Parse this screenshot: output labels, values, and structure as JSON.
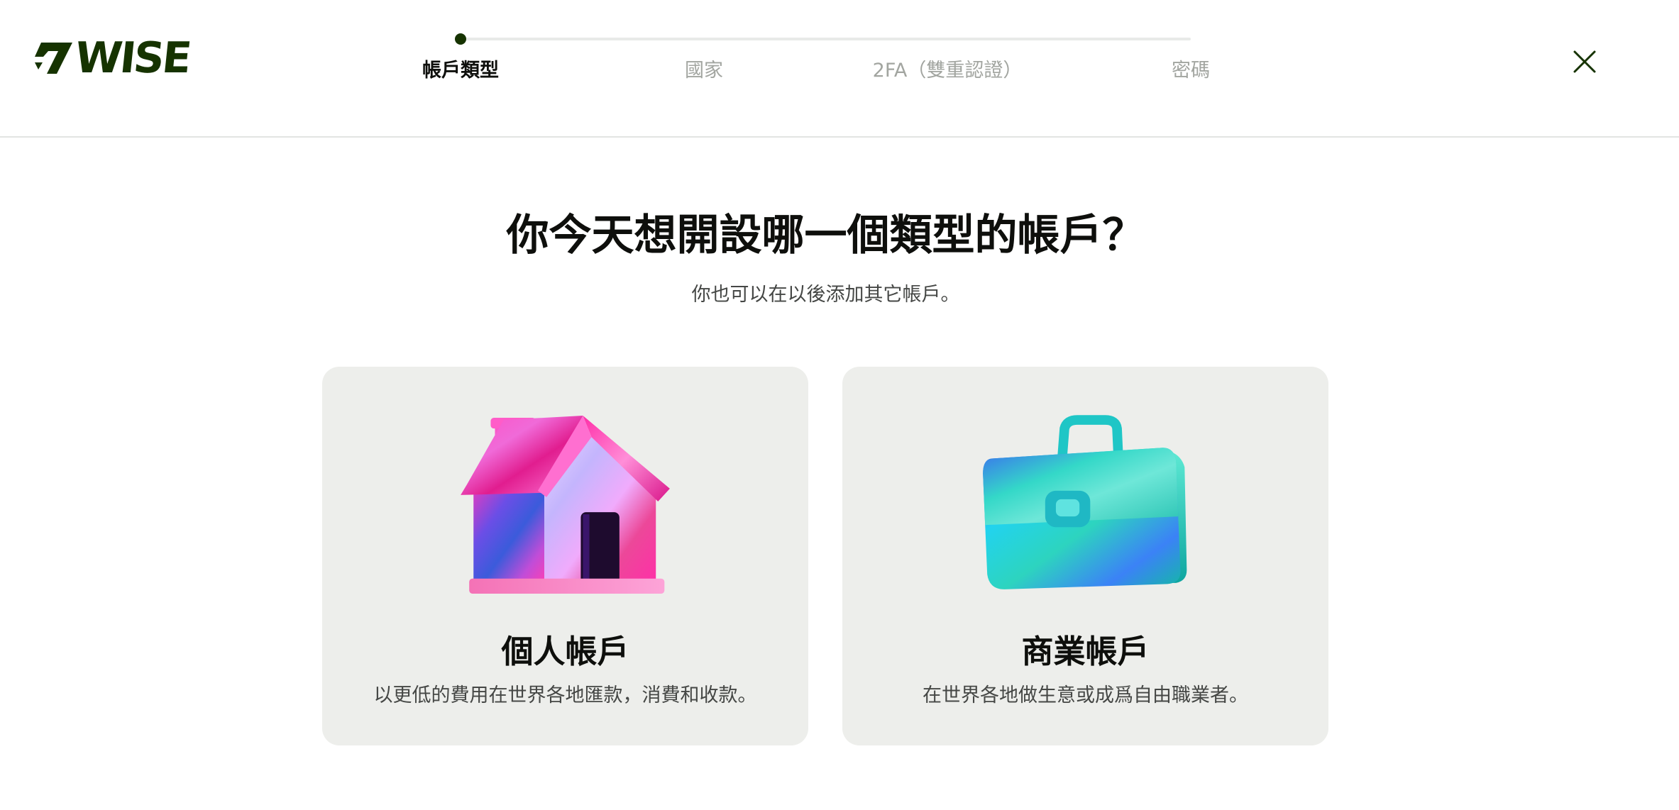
{
  "logo": {
    "text": "WISE",
    "icon": "wise-flag-icon",
    "brand_color": "#163300"
  },
  "stepper": {
    "current_step": 1,
    "total_steps": 4,
    "steps": [
      {
        "label": "帳戶類型"
      },
      {
        "label": "國家"
      },
      {
        "label": "2FA（雙重認證）"
      },
      {
        "label": "密碼"
      }
    ]
  },
  "header": {
    "close_icon": "close-icon"
  },
  "main": {
    "title": "你今天想開設哪一個類型的帳戶？",
    "subtitle": "你也可以在以後添加其它帳戶。"
  },
  "cards": [
    {
      "title": "個人帳戶",
      "description": "以更低的費用在世界各地匯款，消費和收款。",
      "illustration": "house-icon"
    },
    {
      "title": "商業帳戶",
      "description": "在世界各地做生意或成爲自由職業者。",
      "illustration": "briefcase-icon"
    }
  ],
  "colors": {
    "brand": "#163300",
    "card_background": "#edeeeb",
    "inactive_step": "#a2a5a0",
    "body_text": "#454745"
  }
}
